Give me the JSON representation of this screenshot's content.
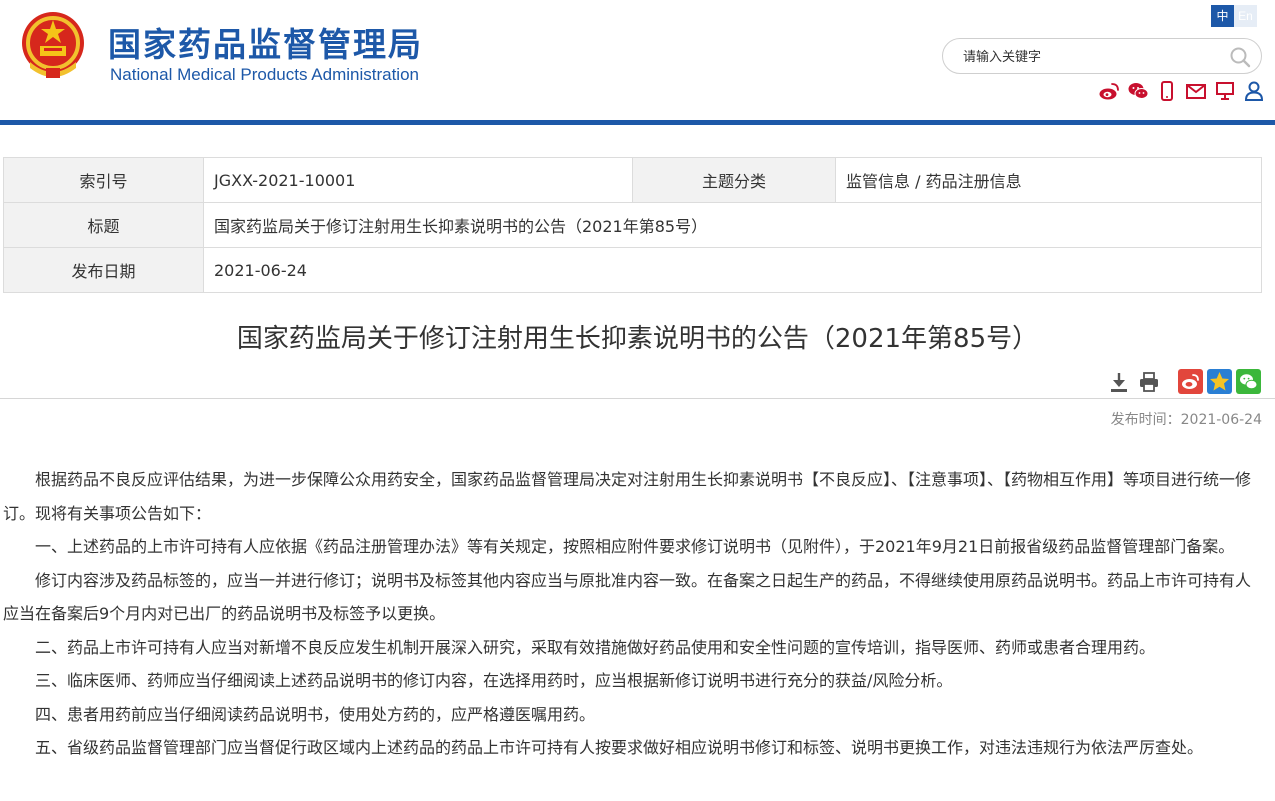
{
  "header": {
    "logo_cn": "国家药品监督管理局",
    "logo_en": "National Medical Products Administration",
    "lang_zh": "中",
    "lang_en": "En",
    "search_placeholder": "请输入关键字",
    "social_icons": [
      "weibo-icon",
      "wechat-icon",
      "mobile-icon",
      "mail-icon",
      "monitor-icon",
      "user-icon"
    ],
    "colors": {
      "brand": "#1d58a8",
      "social": "#c8102e"
    }
  },
  "meta": {
    "index_label": "索引号",
    "index_value": "JGXX-2021-10001",
    "category_label": "主题分类",
    "category_value": "监管信息 / 药品注册信息",
    "title_label": "标题",
    "title_value": "国家药监局关于修订注射用生长抑素说明书的公告（2021年第85号）",
    "date_label": "发布日期",
    "date_value": "2021-06-24"
  },
  "article": {
    "title": "国家药监局关于修订注射用生长抑素说明书的公告（2021年第85号）",
    "publish_time": "发布时间：2021-06-24",
    "tools": [
      "download-icon",
      "print-icon",
      "weibo-share-icon",
      "qzone-share-icon",
      "wechat-share-icon"
    ],
    "paragraphs": [
      "根据药品不良反应评估结果，为进一步保障公众用药安全，国家药品监督管理局决定对注射用生长抑素说明书【不良反应】、【注意事项】、【药物相互作用】等项目进行统一修订。现将有关事项公告如下：",
      "一、上述药品的上市许可持有人应依据《药品注册管理办法》等有关规定，按照相应附件要求修订说明书（见附件），于2021年9月21日前报省级药品监督管理部门备案。",
      "修订内容涉及药品标签的，应当一并进行修订；说明书及标签其他内容应当与原批准内容一致。在备案之日起生产的药品，不得继续使用原药品说明书。药品上市许可持有人应当在备案后9个月内对已出厂的药品说明书及标签予以更换。",
      "二、药品上市许可持有人应当对新增不良反应发生机制开展深入研究，采取有效措施做好药品使用和安全性问题的宣传培训，指导医师、药师或患者合理用药。",
      "三、临床医师、药师应当仔细阅读上述药品说明书的修订内容，在选择用药时，应当根据新修订说明书进行充分的获益/风险分析。",
      "四、患者用药前应当仔细阅读药品说明书，使用处方药的，应严格遵医嘱用药。",
      "五、省级药品监督管理部门应当督促行政区域内上述药品的药品上市许可持有人按要求做好相应说明书修订和标签、说明书更换工作，对违法违规行为依法严厉查处。"
    ]
  }
}
